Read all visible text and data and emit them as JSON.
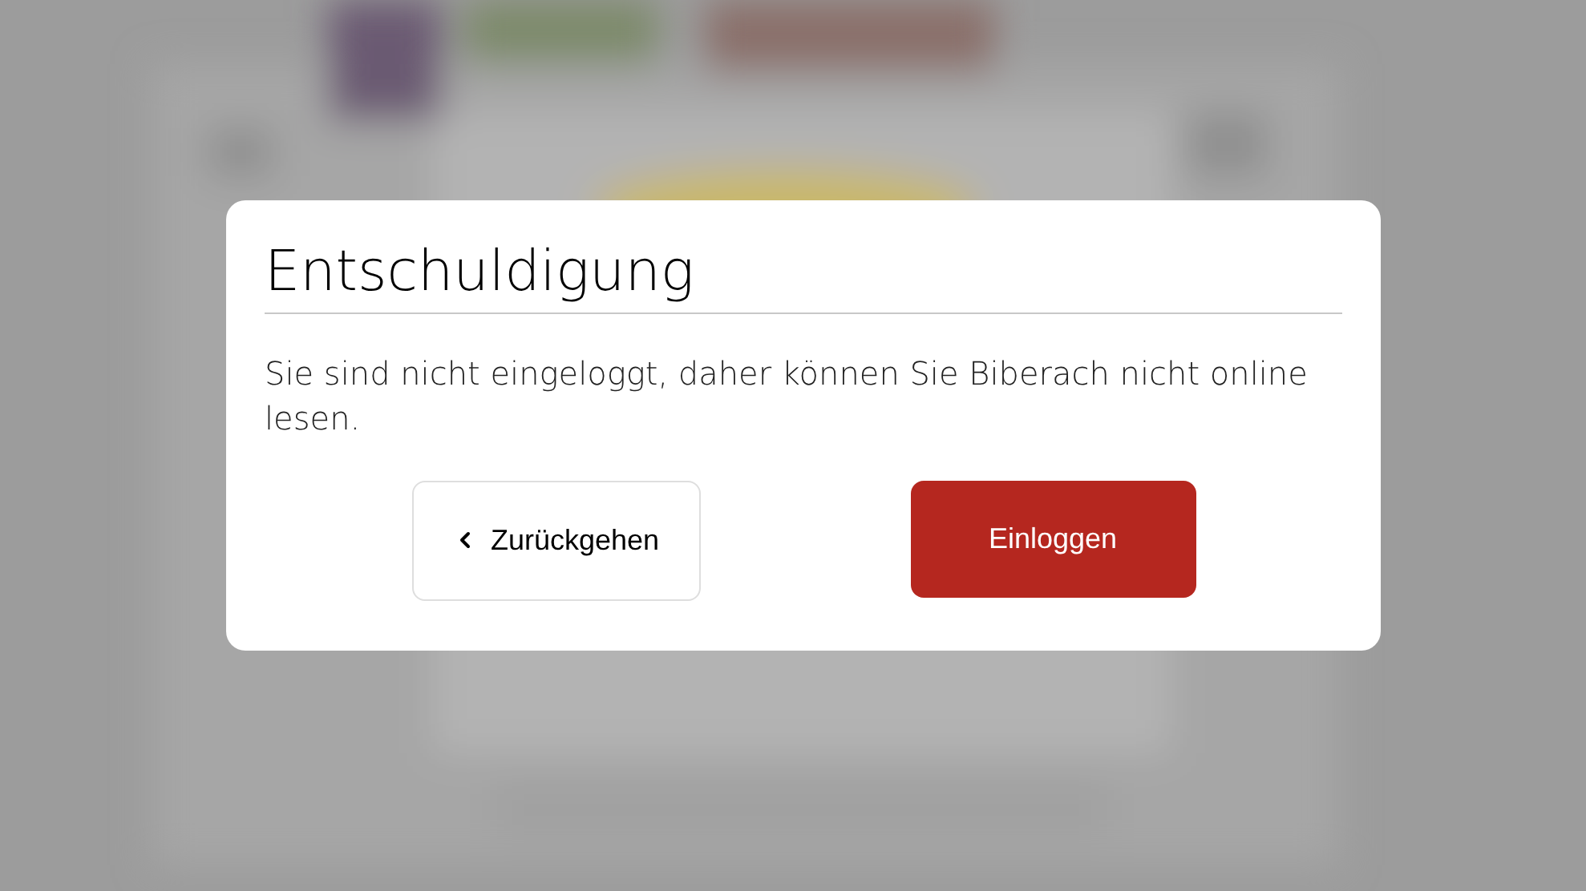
{
  "dialog": {
    "title": "Entschuldigung",
    "message": "Sie sind nicht eingeloggt, daher können Sie Biberach nicht online lesen.",
    "buttons": [
      {
        "kind": "back",
        "label": "Zurückgehen"
      },
      {
        "kind": "primary",
        "label": "Einloggen"
      }
    ]
  }
}
